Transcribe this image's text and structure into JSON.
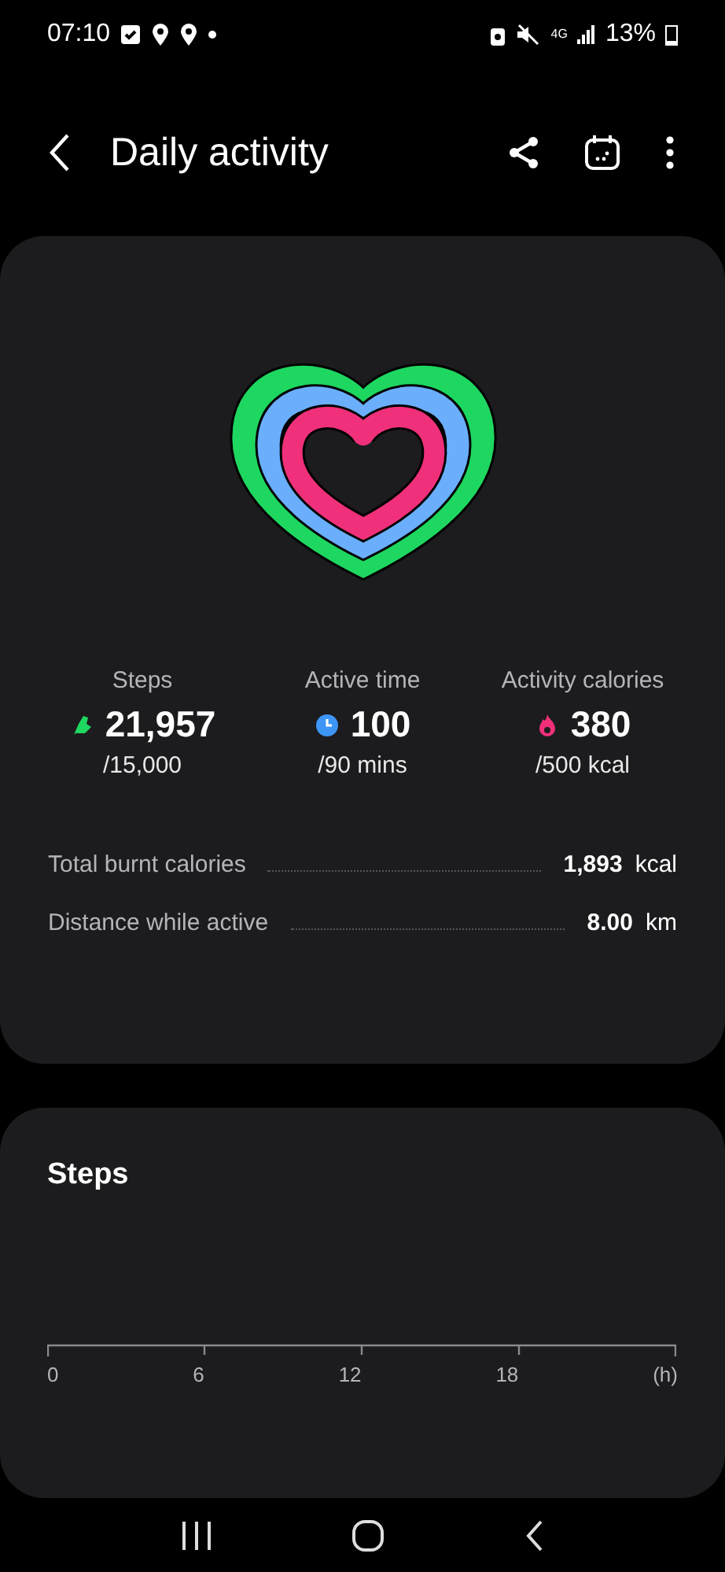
{
  "status_bar": {
    "time": "07:10",
    "network": "4G",
    "battery": "13%"
  },
  "header": {
    "title": "Daily activity"
  },
  "rings": [
    {
      "color": "#1ed760"
    },
    {
      "color": "#6aaefc"
    },
    {
      "color": "#f0307a"
    }
  ],
  "goals": [
    {
      "kind": "steps",
      "label": "Steps",
      "value": "21,957",
      "target": "/15,000"
    },
    {
      "kind": "time",
      "label": "Active time",
      "value": "100",
      "target": "/90 mins"
    },
    {
      "kind": "calories",
      "label": "Activity calories",
      "value": "380",
      "target": "/500 kcal"
    }
  ],
  "details": [
    {
      "label": "Total burnt calories",
      "value": "1,893",
      "unit": "kcal"
    },
    {
      "label": "Distance while active",
      "value": "8.00",
      "unit": "km"
    }
  ],
  "steps_card": {
    "title": "Steps",
    "axis_labels": [
      "0",
      "6",
      "12",
      "18",
      "(h)"
    ]
  }
}
